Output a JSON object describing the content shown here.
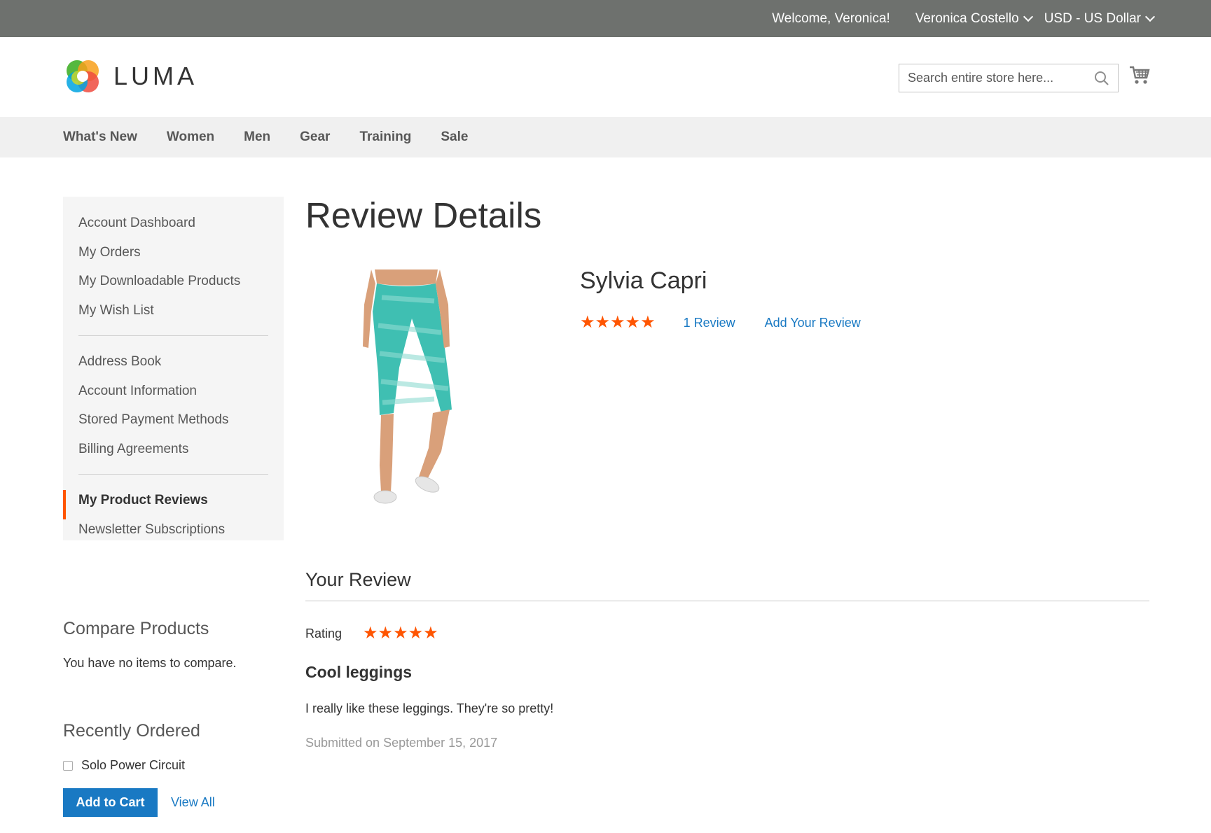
{
  "top_panel": {
    "welcome": "Welcome, Veronica!",
    "account_name": "Veronica Costello",
    "currency": "USD - US Dollar"
  },
  "header": {
    "logo_text": "LUMA",
    "search_placeholder": "Search entire store here...",
    "icons": [
      "search-icon",
      "cart-icon"
    ]
  },
  "nav": {
    "items": [
      "What's New",
      "Women",
      "Men",
      "Gear",
      "Training",
      "Sale"
    ]
  },
  "sidebar": {
    "items": [
      "Account Dashboard",
      "My Orders",
      "My Downloadable Products",
      "My Wish List",
      "Address Book",
      "Account Information",
      "Stored Payment Methods",
      "Billing Agreements",
      "My Product Reviews",
      "Newsletter Subscriptions"
    ],
    "active": "My Product Reviews"
  },
  "compare": {
    "title": "Compare Products",
    "text": "You have no items to compare."
  },
  "recent": {
    "title": "Recently Ordered",
    "item": "Solo Power Circuit",
    "add_to_cart": "Add to Cart",
    "view_all": "View All"
  },
  "main": {
    "page_title": "Review Details",
    "product_name": "Sylvia Capri",
    "summary_stars": "★★★★★",
    "review_count": "1  Review",
    "add_review": "Add Your Review"
  },
  "review": {
    "section_title": "Your Review",
    "rating_label": "Rating",
    "stars": "★★★★★",
    "title": "Cool leggings",
    "text": "I really like these leggings. They're so pretty!",
    "submitted": "Submitted on September 15, 2017"
  },
  "colors": {
    "top_panel": "#6e716e",
    "accent_orange": "#ff5501",
    "link_blue": "#1979c3",
    "nav_bg": "#f0f0f0",
    "sidebar_bg": "#f5f5f5"
  }
}
